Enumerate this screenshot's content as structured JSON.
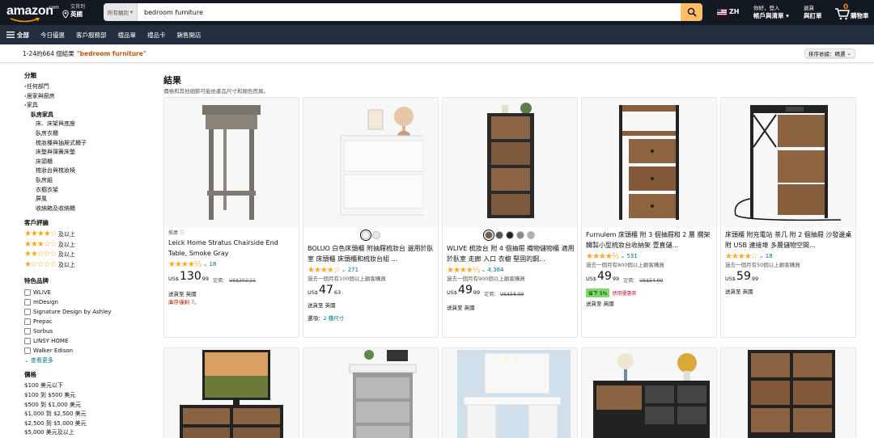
{
  "header": {
    "logo": "amazon",
    "logo_sub": ".com",
    "deliver_line1": "交貨到",
    "deliver_line2": "英國",
    "search_category": "所有類別",
    "search_value": "bedroom furniture",
    "lang": "ZH",
    "account_line1": "你好，登入",
    "account_line2": "帳戶與清單",
    "orders_line1": "退貨",
    "orders_line2": "與訂單",
    "cart_count": "0",
    "cart_label": "購物車"
  },
  "subnav": {
    "all": "全部",
    "items": [
      "今日優惠",
      "客戶服務部",
      "禮品單",
      "禮品卡",
      "銷售開店"
    ]
  },
  "resultbar": {
    "count": "1-24的664 個結果",
    "query": "\"bedroom furniture\"",
    "sort": "排序依據：精選"
  },
  "sidebar": {
    "category_heading": "分類",
    "categories": [
      {
        "label": "任何部門",
        "level": 0,
        "chev": true
      },
      {
        "label": "居家與廚房",
        "level": 0,
        "chev": true
      },
      {
        "label": "家具",
        "level": 0,
        "chev": true
      },
      {
        "label": "臥房家具",
        "level": 1,
        "chev": false,
        "bold": true
      },
      {
        "label": "床、床架與底座",
        "level": 2
      },
      {
        "label": "臥房衣櫃",
        "level": 2
      },
      {
        "label": "梳妝檯與抽屜式櫃子",
        "level": 2
      },
      {
        "label": "床墊與彈簧床墊",
        "level": 2
      },
      {
        "label": "床頭櫃",
        "level": 2
      },
      {
        "label": "梳妝台與梳妝椅",
        "level": 2
      },
      {
        "label": "臥房組",
        "level": 2
      },
      {
        "label": "衣櫥衣架",
        "level": 2
      },
      {
        "label": "屏風",
        "level": 2
      },
      {
        "label": "收納箱及收納櫃",
        "level": 2
      }
    ],
    "review_heading": "客戶評論",
    "reviews": [
      {
        "stars": "★★★★☆",
        "label": "及以上"
      },
      {
        "stars": "★★★☆☆",
        "label": "及以上"
      },
      {
        "stars": "★★☆☆☆",
        "label": "及以上"
      },
      {
        "stars": "★☆☆☆☆",
        "label": "及以上"
      }
    ],
    "brand_heading": "特色品牌",
    "brands": [
      "WLIVE",
      "mDesign",
      "Signature Design by Ashley",
      "Prepac",
      "Sorbus",
      "LINSY HOME",
      "Walker Edison"
    ],
    "see_more": "查看更多",
    "price_heading": "價格",
    "prices": [
      "$100 美元以下",
      "$100 到 $500 美元",
      "$500 到 $1,000 美元",
      "$1,000 到 $2,500 美元",
      "$2,500 到 $5,000 美元",
      "$5,000 美元及以上"
    ]
  },
  "main": {
    "title": "結果",
    "subtitle": "價格和其他細節可能依產品尺寸和顏色而異。",
    "products": [
      {
        "sponsored": "推廣",
        "title": "Leick Home Stratus Chairside End Table, Smoke Gray",
        "stars": "★★★★½",
        "reviews": "18",
        "bought": "",
        "currency": "US$",
        "whole": "130",
        "frac": "99",
        "list_label": "定價：",
        "list_price": "US$202.21",
        "deal": "",
        "deal_label": "",
        "ship": "送貨至 英國",
        "stock": "庫存僅剩 7。"
      },
      {
        "sponsored": "",
        "title": "BOLUO 白色床頭櫃 附抽屜梳妝台 邊用於臥室 床頭櫃 床頭櫃和梳妝台組 ...",
        "stars": "★★★★☆",
        "reviews": "271",
        "bought": "過去一個月有100個以上顧客購買",
        "currency": "US$",
        "whole": "47",
        "frac": "63",
        "list_label": "",
        "list_price": "",
        "deal": "",
        "deal_label": "",
        "ship": "送貨至 英國",
        "stock": "",
        "options_label": "選項：",
        "options_value": "2 種尺寸"
      },
      {
        "sponsored": "",
        "title": "WLIVE 梳妝台 附 4 個抽屜 織物儲物櫃 適用於臥室 走廊 入口 衣櫥 堅固的鋼...",
        "stars": "★★★★½",
        "reviews": "4,364",
        "bought": "過去一個月有900個以上顧客購買",
        "currency": "US$",
        "whole": "49",
        "frac": "99",
        "list_label": "定價：",
        "list_price": "US$58.99",
        "deal": "",
        "deal_label": "",
        "ship": "送貨至 英國",
        "stock": ""
      },
      {
        "sponsored": "",
        "title": "Furnulem 床頭櫃 附 3 個抽屜和 2 層 擱架 鐵製小型梳妝台收納架 壹直儲...",
        "stars": "★★★★½",
        "reviews": "531",
        "bought": "過去一個月有800個以上顧客購買",
        "currency": "US$",
        "whole": "49",
        "frac": "99",
        "list_label": "定價：",
        "list_price": "US$54.99",
        "deal": "省下 5%",
        "deal_label": "使用優惠券",
        "ship": "送貨至 英國",
        "stock": ""
      },
      {
        "sponsored": "",
        "title": "床頭櫃 附充電站 茶几 附 2 個抽屜 沙發邊桌 附 USB 連接埠 多層儲物空間...",
        "stars": "★★★★☆",
        "reviews": "18",
        "bought": "過去一個月有50個以上顧客購買",
        "currency": "US$",
        "whole": "59",
        "frac": "99",
        "list_label": "",
        "list_price": "",
        "deal": "",
        "deal_label": "",
        "ship": "送貨至 英國",
        "stock": ""
      }
    ]
  }
}
